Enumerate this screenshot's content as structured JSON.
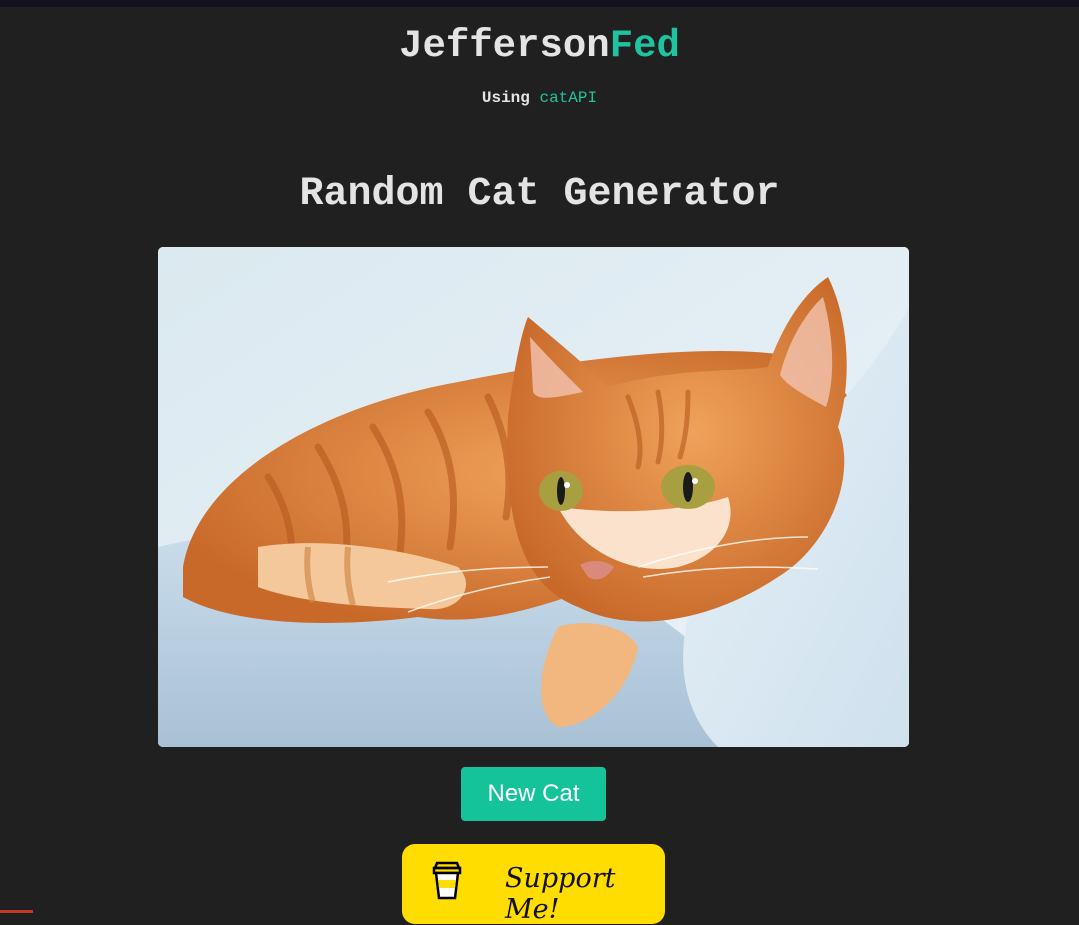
{
  "header": {
    "brand_part1": "Jefferson",
    "brand_part2": "Fed",
    "using_prefix": "Using",
    "using_link": "catAPI"
  },
  "main": {
    "title": "Random Cat Generator",
    "image_alt": "orange tabby cat lying on blanket",
    "new_cat_label": "New Cat",
    "support_label": "Support Me!"
  },
  "colors": {
    "background": "#202020",
    "accent": "#1ec3a0",
    "button": "#15c39a",
    "support": "#ffdd00"
  },
  "icons": {
    "support": "coffee-cup-icon"
  }
}
